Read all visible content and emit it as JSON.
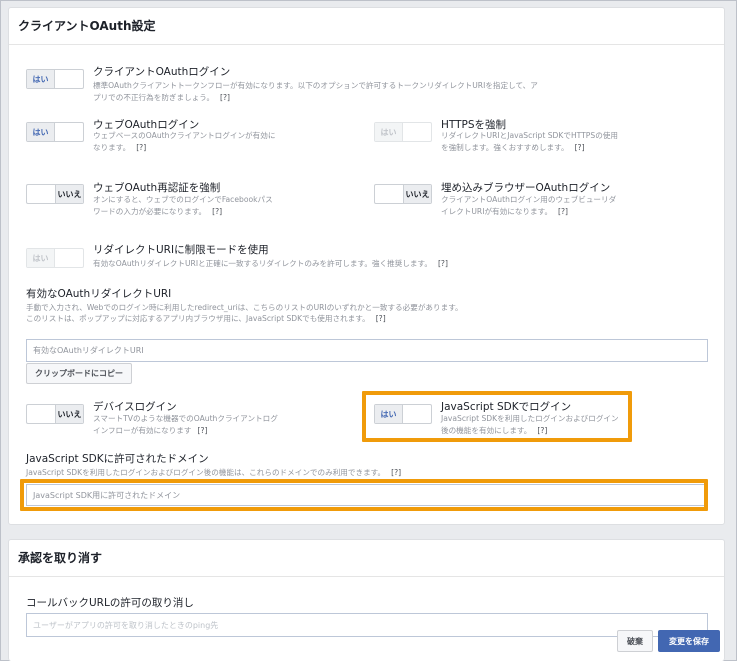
{
  "oauth_panel": {
    "title": "クライアントOAuth設定",
    "client_oauth_login": {
      "toggle": "はい",
      "title": "クライアントOAuthログイン",
      "desc": "標準OAuthクライアントトークンフローが有効になります。以下のオプションで許可するトークンリダイレクトURIを指定して、アプリでの不正行為を防ぎましょう。",
      "help": "[?]"
    },
    "web_oauth_login": {
      "toggle": "はい",
      "title": "ウェブOAuthログイン",
      "desc": "ウェブベースのOAuthクライアントログインが有効になります。",
      "help": "[?]"
    },
    "force_https": {
      "toggle": "はい",
      "title": "HTTPSを強制",
      "desc": "リダイレクトURIとJavaScript SDKでHTTPSの使用を強制します。強くおすすめします。",
      "help": "[?]"
    },
    "force_web_reauth": {
      "toggle": "いいえ",
      "title": "ウェブOAuth再認証を強制",
      "desc": "オンにすると、ウェブでのログインでFacebookパスワードの入力が必要になります。",
      "help": "[?]"
    },
    "embedded_browser_login": {
      "toggle": "いいえ",
      "title": "埋め込みブラウザーOAuthログイン",
      "desc": "クライアントOAuthログイン用のウェブビューリダイレクトURIが有効になります。",
      "help": "[?]"
    },
    "strict_mode": {
      "toggle": "はい",
      "title": "リダイレクトURIに制限モードを使用",
      "desc": "有効なOAuthリダイレクトURIと正確に一致するリダイレクトのみを許可します。強く推奨します。",
      "help": "[?]"
    },
    "valid_redirect": {
      "label": "有効なOAuthリダイレクトURI",
      "desc": "手動で入力され、Webでのログイン時に利用したredirect_uriは、こちらのリストのURIのいずれかと一致する必要があります。このリストは、ポップアップに対応するアプリ内ブラウザ用に、JavaScript SDKでも使用されます。",
      "help": "[?]",
      "placeholder": "有効なOAuthリダイレクトURI",
      "copy_button": "クリップボードにコピー"
    },
    "device_login": {
      "toggle": "いいえ",
      "title": "デバイスログイン",
      "desc": "スマートTVのような機器でのOAuthクライアントログインフローが有効になります",
      "help": "[?]"
    },
    "js_sdk_login": {
      "toggle": "はい",
      "title": "JavaScript SDKでログイン",
      "desc": "JavaScript SDKを利用したログインおよびログイン後の機能を有効にします。",
      "help": "[?]"
    },
    "js_sdk_domains": {
      "label": "JavaScript SDKに許可されたドメイン",
      "desc": "JavaScript SDKを利用したログインおよびログイン後の機能は、これらのドメインでのみ利用できます。",
      "help": "[?]",
      "placeholder": "JavaScript SDK用に許可されたドメイン"
    }
  },
  "deauth_panel": {
    "title": "承認を取り消す",
    "callback_label": "コールバックURLの許可の取り消し",
    "callback_placeholder": "ユーザーがアプリの許可を取り消したときのping先"
  },
  "footer": {
    "discard": "破棄",
    "save": "変更を保存"
  },
  "colors": {
    "highlight": "#f09b0a",
    "brand": "#4267b2"
  }
}
